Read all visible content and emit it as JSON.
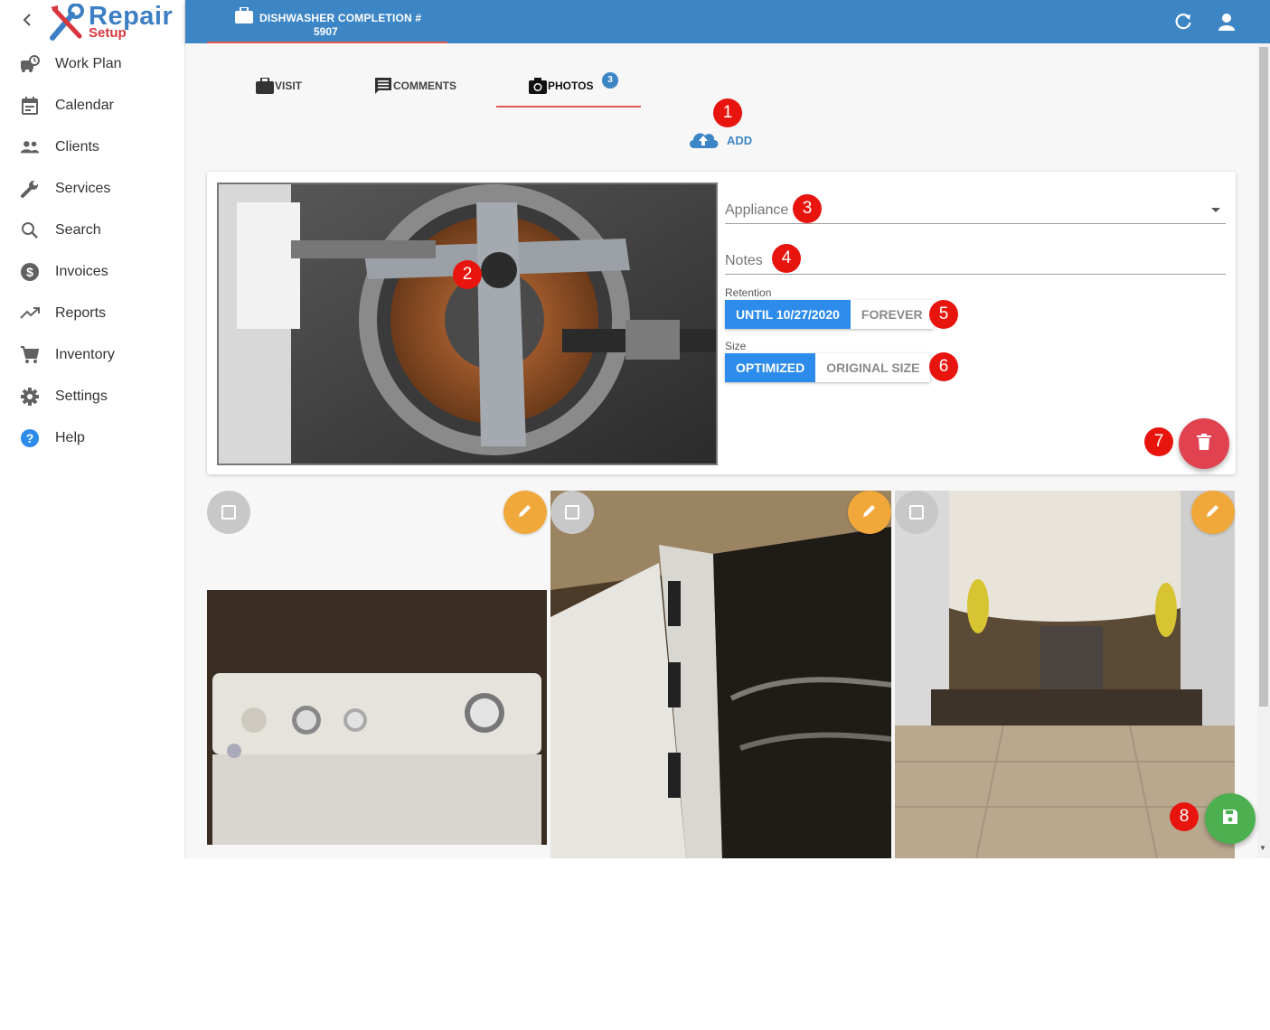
{
  "app": {
    "logo_line1": "Repair",
    "logo_line2": "Setup",
    "brand_blue": "#3d7fc4",
    "brand_red": "#d9363e"
  },
  "sidebar": {
    "items": [
      {
        "label": "Work Plan",
        "icon": "work-plan-icon"
      },
      {
        "label": "Calendar",
        "icon": "calendar-icon"
      },
      {
        "label": "Clients",
        "icon": "clients-icon"
      },
      {
        "label": "Services",
        "icon": "wrench-icon"
      },
      {
        "label": "Search",
        "icon": "search-icon"
      },
      {
        "label": "Invoices",
        "icon": "dollar-icon"
      },
      {
        "label": "Reports",
        "icon": "trend-icon"
      },
      {
        "label": "Inventory",
        "icon": "cart-icon"
      },
      {
        "label": "Settings",
        "icon": "gear-icon"
      },
      {
        "label": "Help",
        "icon": "help-icon"
      }
    ]
  },
  "header": {
    "title": "DISHWASHER COMPLETION #",
    "number": "5907",
    "color": "#3d86c6"
  },
  "tabs": {
    "visit": "VISIT",
    "comments": "COMMENTS",
    "photos": "PHOTOS",
    "photos_count": "3"
  },
  "add": {
    "label": "ADD"
  },
  "editor": {
    "appliance_label": "Appliance",
    "notes_label": "Notes",
    "retention_label": "Retention",
    "retention_options": [
      "UNTIL 10/27/2020",
      "FOREVER"
    ],
    "retention_selected": "UNTIL 10/27/2020",
    "size_label": "Size",
    "size_options": [
      "OPTIMIZED",
      "ORIGINAL SIZE"
    ],
    "size_selected": "OPTIMIZED"
  },
  "markers": [
    "1",
    "2",
    "3",
    "4",
    "5",
    "6",
    "7",
    "8"
  ]
}
